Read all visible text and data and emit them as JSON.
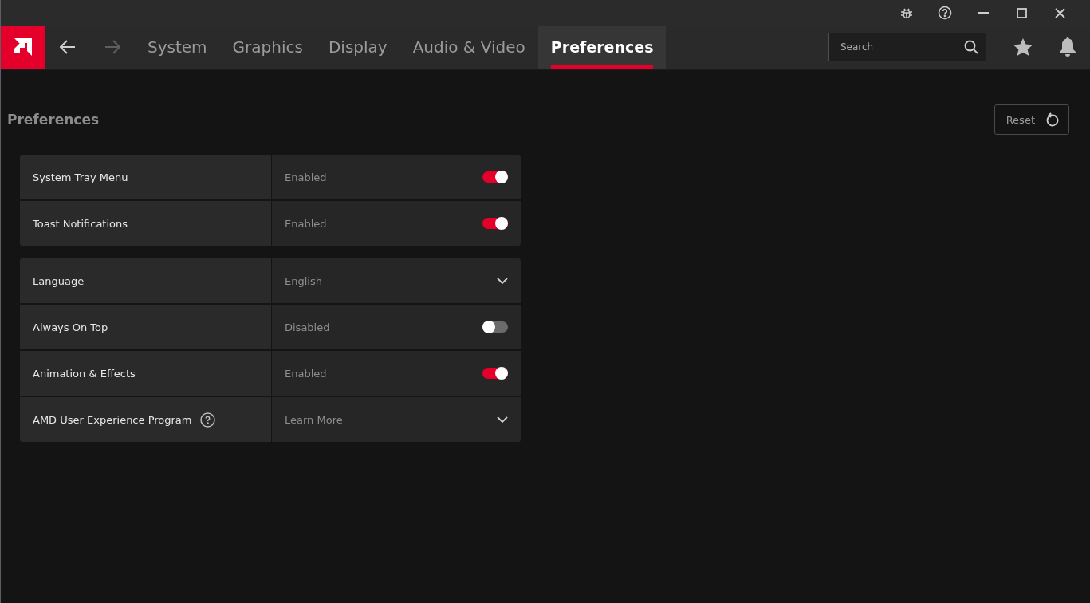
{
  "nav": {
    "back": {
      "disabled": false
    },
    "forward": {
      "disabled": true
    },
    "tabs": [
      {
        "label": "System",
        "selected": false
      },
      {
        "label": "Graphics",
        "selected": false
      },
      {
        "label": "Display",
        "selected": false
      },
      {
        "label": "Audio & Video",
        "selected": false
      },
      {
        "label": "Preferences",
        "selected": true
      }
    ]
  },
  "search": {
    "placeholder": "Search"
  },
  "page": {
    "title": "Preferences",
    "reset_button": "Reset"
  },
  "groups": [
    {
      "rows": [
        {
          "label": "System Tray Menu",
          "value": "Enabled",
          "kind": "toggle",
          "on": true
        },
        {
          "label": "Toast Notifications",
          "value": "Enabled",
          "kind": "toggle",
          "on": true
        }
      ]
    },
    {
      "rows": [
        {
          "label": "Language",
          "value": "English",
          "kind": "dropdown"
        },
        {
          "label": "Always On Top",
          "value": "Disabled",
          "kind": "toggle",
          "on": false
        },
        {
          "label": "Animation & Effects",
          "value": "Enabled",
          "kind": "toggle",
          "on": true
        },
        {
          "label": "AMD User Experience Program",
          "value": "Learn More",
          "kind": "dropdown",
          "help_icon": true
        }
      ]
    }
  ]
}
